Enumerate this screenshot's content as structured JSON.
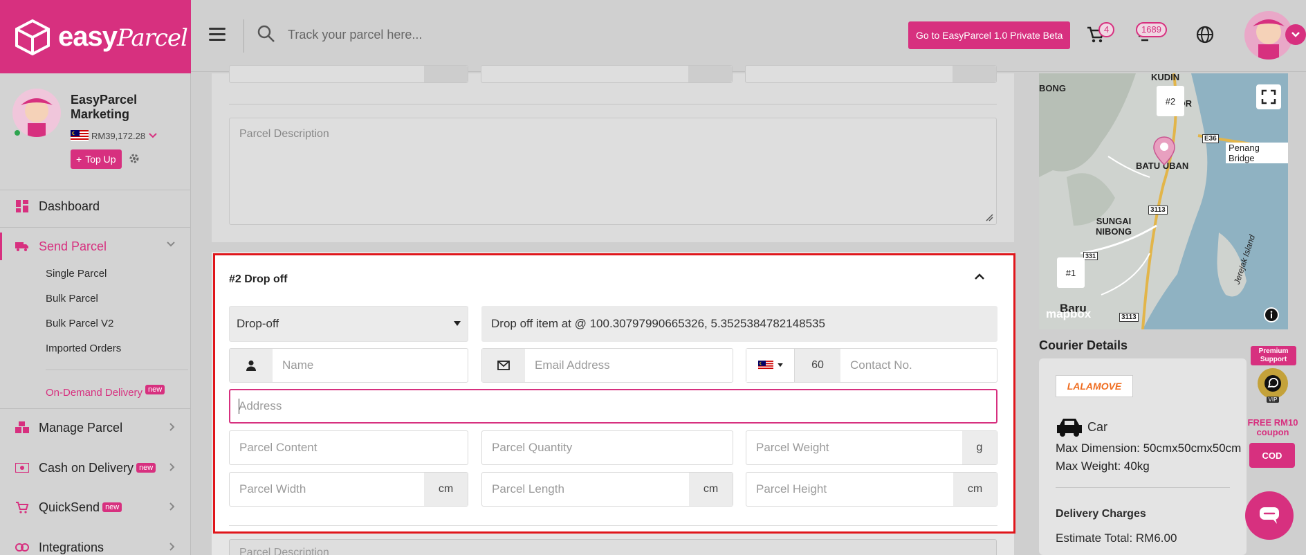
{
  "brand": {
    "name_easy": "easy",
    "name_parcel": "Parcel"
  },
  "header": {
    "search_placeholder": "Track your parcel here...",
    "beta_button": "Go to EasyParcel 1.0 Private Beta",
    "cart_count": "4",
    "inbox_count": "1689"
  },
  "profile": {
    "name": "EasyParcel Marketing",
    "balance": "RM39,172.28",
    "topup_label": "Top Up"
  },
  "sidebar": {
    "dashboard": "Dashboard",
    "send_parcel": "Send Parcel",
    "sub_items": [
      "Single Parcel",
      "Bulk Parcel",
      "Bulk Parcel V2",
      "Imported Orders"
    ],
    "on_demand": "On-Demand Delivery",
    "manage_parcel": "Manage Parcel",
    "cod": "Cash on Delivery",
    "quicksend": "QuickSend",
    "integrations": "Integrations",
    "new_tag": "new"
  },
  "sender": {
    "description_placeholder": "Parcel Description"
  },
  "dropoff": {
    "title": "#2 Drop off",
    "mode_value": "Drop-off",
    "location_text": "Drop off item at @ 100.30797990665326, 5.3525384782148535",
    "name_placeholder": "Name",
    "email_placeholder": "Email Address",
    "country_code": "60",
    "contact_placeholder": "Contact No.",
    "address_placeholder": "Address",
    "content_placeholder": "Parcel Content",
    "quantity_placeholder": "Parcel Quantity",
    "weight_placeholder": "Parcel Weight",
    "weight_unit": "g",
    "width_placeholder": "Parcel Width",
    "length_placeholder": "Parcel Length",
    "height_placeholder": "Parcel Height",
    "dim_unit": "cm",
    "next_description_placeholder": "Parcel Description"
  },
  "map": {
    "labels": {
      "bong": "BONG",
      "kudin": "KUDIN",
      "ugor": "UGOR",
      "batu_uban": "BATU UBAN",
      "penang_bridge": "Penang Bridge",
      "e36": "E36",
      "road_3113": "3113",
      "sungai_nibong": "SUNGAI NIBONG",
      "baru": "Baru",
      "island": "Jerejak Island",
      "road_331": "331",
      "attribution": "mapbox"
    },
    "markers": [
      "#2",
      "#1"
    ]
  },
  "courier": {
    "section_title": "Courier Details",
    "provider": "LALAMOVE",
    "vehicle": "Car",
    "max_dimension": "Max Dimension: 50cmx50cmx50cm",
    "max_weight": "Max Weight: 40kg",
    "charges_title": "Delivery Charges",
    "estimate_total": "Estimate Total: RM6.00"
  },
  "promos": {
    "premium_support": "Premium Support",
    "vip": "VIP",
    "coupon": "FREE RM10 coupon",
    "cod": "COD"
  },
  "colors": {
    "brand": "#d7307f",
    "highlight_border": "#e0161b"
  }
}
